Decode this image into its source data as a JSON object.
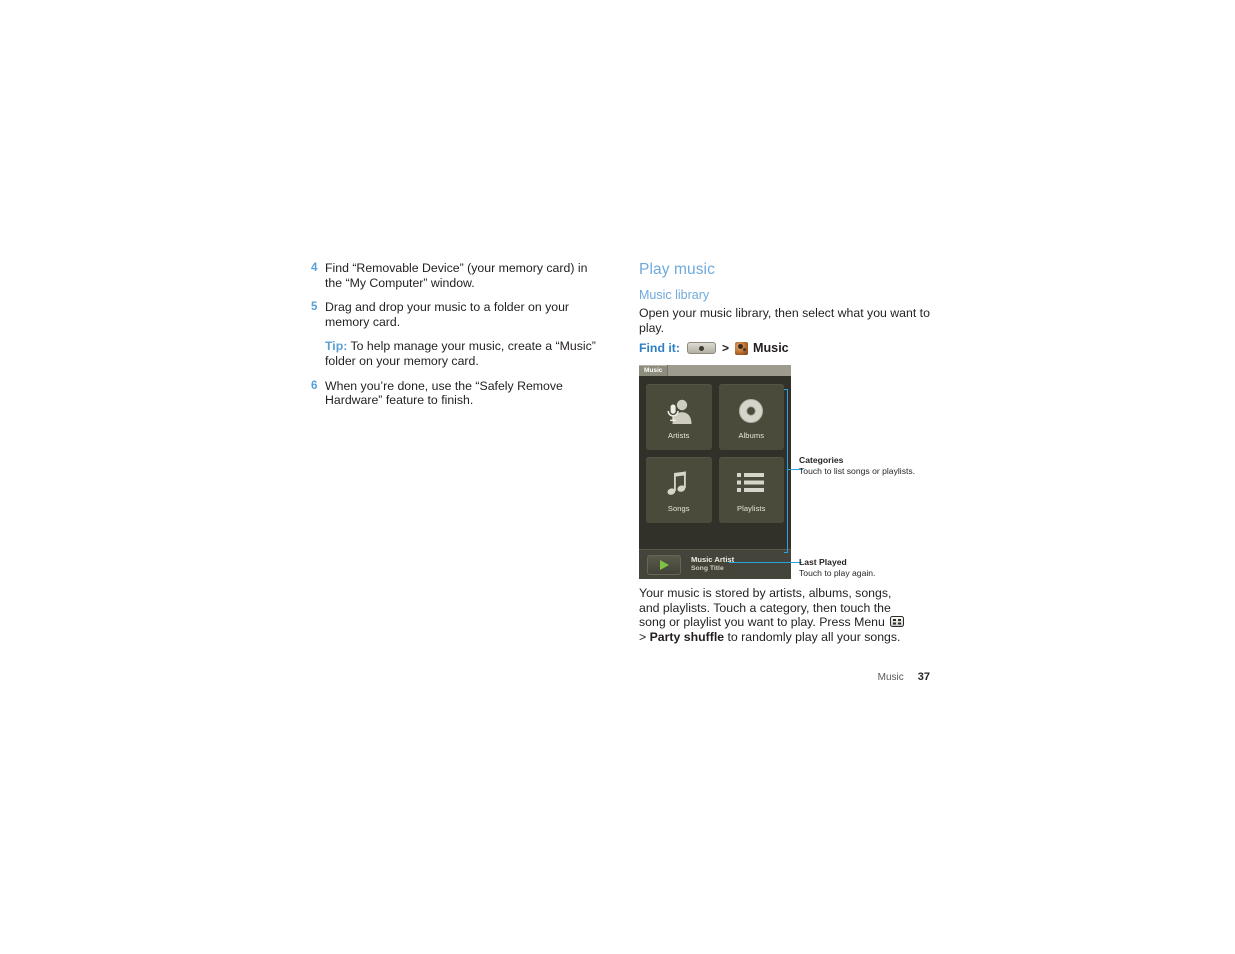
{
  "left_column": {
    "steps": [
      {
        "num": "4",
        "text": "Find “Removable Device” (your memory card) in the “My Computer” window."
      },
      {
        "num": "5",
        "text": "Drag and drop your music to a folder on your memory card."
      }
    ],
    "tip": {
      "label": "Tip:",
      "text": " To help manage your music, create a “Music” folder on your memory card."
    },
    "step6": {
      "num": "6",
      "text": "When you’re done, use the “Safely Remove Hardware” feature to finish."
    }
  },
  "right_column": {
    "heading": "Play music",
    "subheading": "Music library",
    "intro": "Open your music library, then select what you want to play.",
    "find_it": {
      "label": "Find it:",
      "launcher_icon": "app-tray-icon",
      "separator": ">",
      "app_icon": "music-app-icon",
      "target": "Music"
    },
    "after_text": {
      "part1": "Your music is stored by artists, albums, songs, and playlists. Touch a category, then touch the song or playlist you want to play. Press Menu ",
      "menu_icon": "menu-key-icon",
      "part2": " > ",
      "bold_term": "Party shuffle",
      "part3": " to randomly play all your songs."
    }
  },
  "phone_screenshot": {
    "title_tab": "Music",
    "tiles": [
      {
        "label": "Artists",
        "icon": "artist-microphone-icon"
      },
      {
        "label": "Albums",
        "icon": "album-disc-icon"
      },
      {
        "label": "Songs",
        "icon": "music-note-icon"
      },
      {
        "label": "Playlists",
        "icon": "list-bullet-icon"
      }
    ],
    "last_played": {
      "play_icon": "play-triangle-icon",
      "artist": "Music Artist",
      "song": "Song Title"
    }
  },
  "callouts": [
    {
      "title": "Categories",
      "desc": "Touch to list songs or playlists."
    },
    {
      "title": "Last Played",
      "desc": "Touch to play again."
    }
  ],
  "footer": {
    "label": "Music",
    "page": "37"
  },
  "colors": {
    "accent_blue": "#6fa9dd",
    "link_blue": "#2f7fc4",
    "callout_blue": "#29a3e0",
    "phone_bg": "#31312a",
    "tile_bg": "#4b4b3c",
    "titlebar": "#9d9b8d",
    "play_green": "#7dc242"
  }
}
